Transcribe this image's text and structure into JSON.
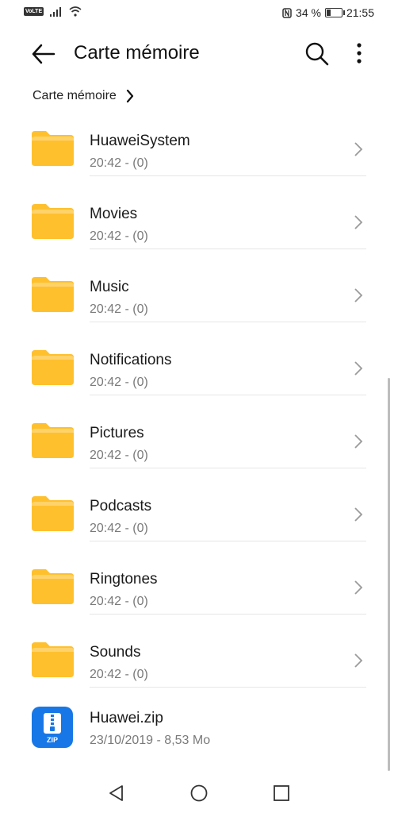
{
  "status_bar": {
    "volte": "VoLTE",
    "battery_percent": "34 %",
    "battery_level": 0.34,
    "time": "21:55"
  },
  "app_bar": {
    "title": "Carte mémoire",
    "back_icon": "arrow-left-icon",
    "search_icon": "search-icon",
    "more_icon": "more-vertical-icon"
  },
  "breadcrumb": {
    "label": "Carte mémoire",
    "icon": "chevron-right-icon"
  },
  "items": [
    {
      "name": "HuaweiSystem",
      "meta": "20:42 - (0)",
      "type": "folder"
    },
    {
      "name": "Movies",
      "meta": "20:42 - (0)",
      "type": "folder"
    },
    {
      "name": "Music",
      "meta": "20:42 - (0)",
      "type": "folder"
    },
    {
      "name": "Notifications",
      "meta": "20:42 - (0)",
      "type": "folder"
    },
    {
      "name": "Pictures",
      "meta": "20:42 - (0)",
      "type": "folder"
    },
    {
      "name": "Podcasts",
      "meta": "20:42 - (0)",
      "type": "folder"
    },
    {
      "name": "Ringtones",
      "meta": "20:42 - (0)",
      "type": "folder"
    },
    {
      "name": "Sounds",
      "meta": "20:42 - (0)",
      "type": "folder"
    },
    {
      "name": "Huawei.zip",
      "meta": "23/10/2019 - 8,53  Mo",
      "type": "zip",
      "badge": "ZIP"
    }
  ],
  "colors": {
    "folder": "#FFC02E",
    "folder_tab": "#FFD36A",
    "zip": "#1877E6"
  },
  "nav_bar": {
    "back_icon": "triangle-back-icon",
    "home_icon": "circle-home-icon",
    "recents_icon": "square-recents-icon"
  }
}
